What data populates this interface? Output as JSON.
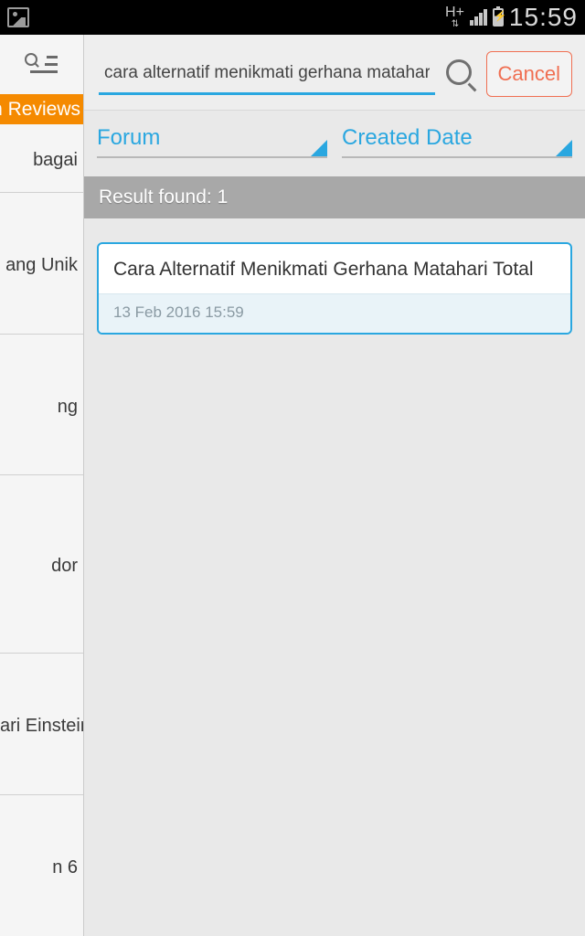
{
  "status": {
    "network_label": "H+",
    "time": "15:59"
  },
  "drawer": {
    "active_tab": "n Reviews",
    "items": [
      "bagai",
      "ang Unik",
      "ng",
      "dor",
      "ari Einstein",
      "n 6"
    ]
  },
  "search": {
    "value": "cara alternatif menikmati gerhana matahari total !",
    "cancel_label": "Cancel"
  },
  "filters": {
    "category": "Forum",
    "sort": "Created Date"
  },
  "result_bar": "Result found: 1",
  "results": [
    {
      "title": "Cara Alternatif Menikmati Gerhana Matahari Total",
      "meta": "13 Feb 2016 15:59"
    }
  ]
}
